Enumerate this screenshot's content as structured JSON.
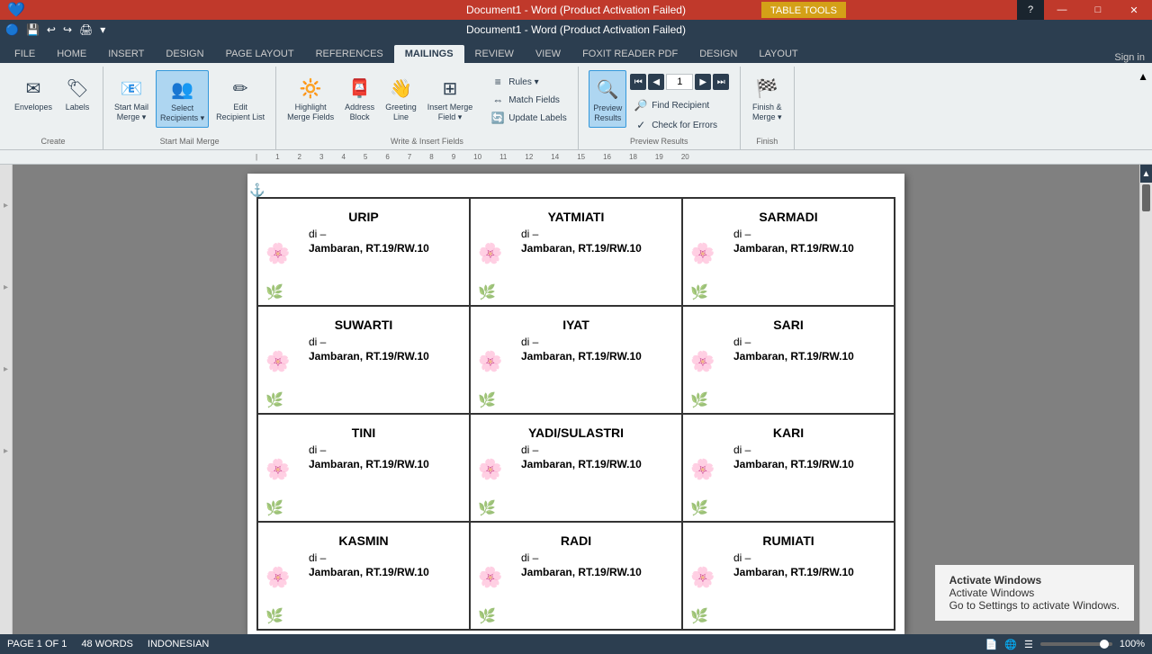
{
  "titlebar": {
    "title": "Document1 - Word (Product Activation Failed)",
    "tabletools": "TABLE TOOLS",
    "help_icon": "?",
    "minimize": "—",
    "maximize": "□",
    "close": "✕"
  },
  "quickaccess": {
    "icons": [
      "💾",
      "↩",
      "↪",
      "📄"
    ]
  },
  "ribbon": {
    "tabs": [
      "FILE",
      "HOME",
      "INSERT",
      "DESIGN",
      "PAGE LAYOUT",
      "REFERENCES",
      "MAILINGS",
      "REVIEW",
      "VIEW",
      "FOXIT READER PDF",
      "DESIGN",
      "LAYOUT"
    ],
    "active_tab": "MAILINGS",
    "sign_in": "Sign in"
  },
  "groups": {
    "create": {
      "label": "Create",
      "buttons": [
        {
          "icon": "✉",
          "label": "Envelopes"
        },
        {
          "icon": "🏷",
          "label": "Labels"
        }
      ]
    },
    "start_mail_merge": {
      "label": "Start Mail Merge",
      "buttons": [
        {
          "icon": "📧",
          "label": "Start Mail\nMerge ▾"
        },
        {
          "icon": "👥",
          "label": "Select\nRecipients ▾"
        },
        {
          "icon": "✏",
          "label": "Edit\nRecipient List"
        }
      ]
    },
    "write_insert": {
      "label": "Write & Insert Fields",
      "buttons_main": [
        {
          "icon": "🔆",
          "label": "Highlight\nMerge Fields"
        },
        {
          "icon": "📮",
          "label": "Address\nBlock"
        },
        {
          "icon": "👋",
          "label": "Greeting\nLine"
        },
        {
          "icon": "⊞",
          "label": "Insert Merge\nField ▾"
        }
      ],
      "buttons_small": [
        "Rules ▾",
        "Match Fields",
        "Update Labels"
      ]
    },
    "preview": {
      "label": "Preview Results",
      "nav_prev_prev": "⏮",
      "nav_prev": "◀",
      "nav_value": "1",
      "nav_next": "▶",
      "nav_next_next": "⏭",
      "preview_btn": "Preview\nResults",
      "small_buttons": [
        "Find Recipient",
        "Check for Errors"
      ]
    },
    "finish": {
      "label": "Finish",
      "button": "Finish &\nMerge ▾"
    }
  },
  "cards": [
    {
      "name": "URIP",
      "di": "di –",
      "address": "Jambaran, RT.19/RW.10"
    },
    {
      "name": "YATMIATI",
      "di": "di –",
      "address": "Jambaran, RT.19/RW.10"
    },
    {
      "name": "SARMADI",
      "di": "di –",
      "address": "Jambaran, RT.19/RW.10"
    },
    {
      "name": "SUWARTI",
      "di": "di –",
      "address": "Jambaran, RT.19/RW.10"
    },
    {
      "name": "IYAT",
      "di": "di –",
      "address": "Jambaran, RT.19/RW.10"
    },
    {
      "name": "SARI",
      "di": "di –",
      "address": "Jambaran, RT.19/RW.10"
    },
    {
      "name": "TINI",
      "di": "di –",
      "address": "Jambaran, RT.19/RW.10"
    },
    {
      "name": "YADI/SULASTRI",
      "di": "di –",
      "address": "Jambaran, RT.19/RW.10"
    },
    {
      "name": "KARI",
      "di": "di –",
      "address": "Jambaran, RT.19/RW.10"
    },
    {
      "name": "KASMIN",
      "di": "di –",
      "address": "Jambaran, RT.19/RW.10"
    },
    {
      "name": "RADI",
      "di": "di –",
      "address": "Jambaran, RT.19/RW.10"
    },
    {
      "name": "RUMIATI",
      "di": "di –",
      "address": "Jambaran, RT.19/RW.10"
    }
  ],
  "statusbar": {
    "page": "PAGE 1 OF 1",
    "words": "48 WORDS",
    "language": "INDONESIAN",
    "zoom": "100%"
  },
  "activate": {
    "line1": "Activate Windows",
    "line2": "Go to Settings to activate Windows."
  }
}
